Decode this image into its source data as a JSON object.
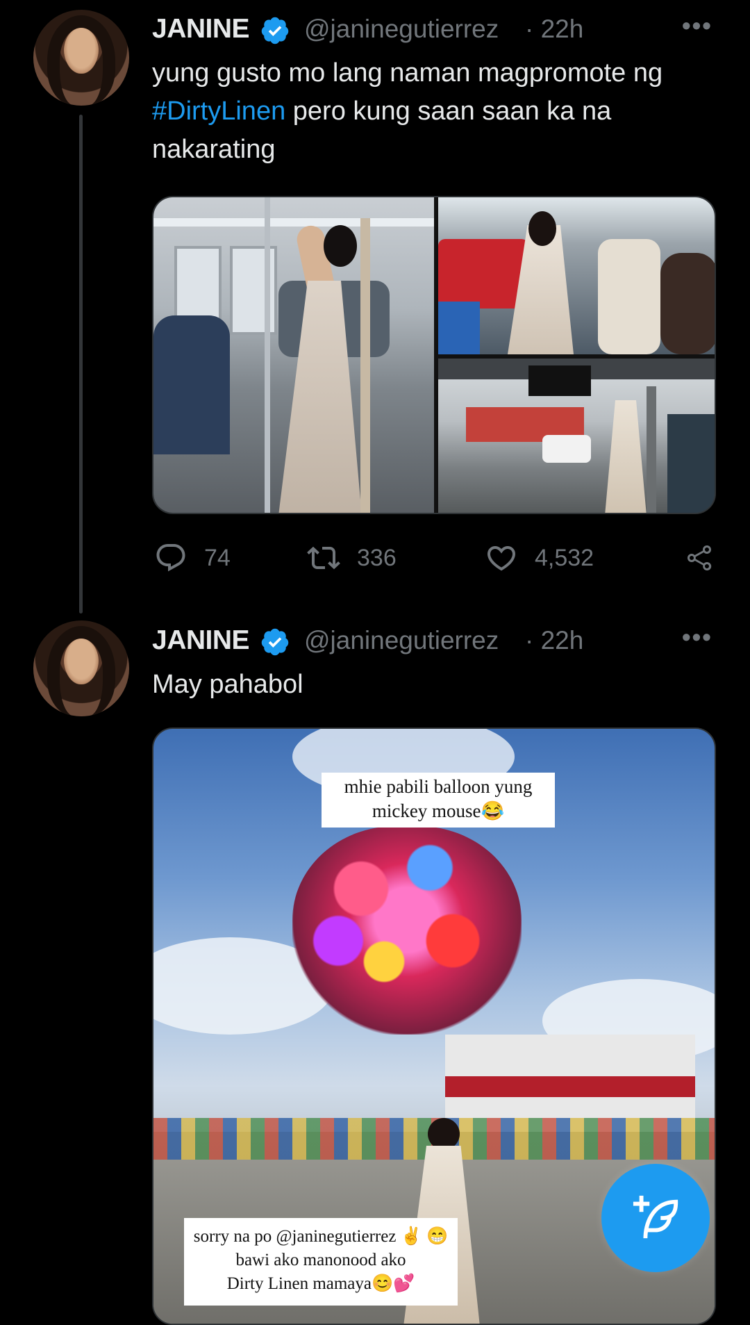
{
  "colors": {
    "background": "#000000",
    "accent": "#1d9bf0",
    "muted": "#71767b",
    "text": "#e7e9ea"
  },
  "tweet1": {
    "name": "JANINE",
    "handle": "@janinegutierrez",
    "time": "· 22h",
    "text_before": "yung gusto mo lang naman magpromote ng",
    "hashtag": "#DirtyLinen",
    "text_after": " pero kung saan saan ka na nakarating",
    "photos": [
      "train-interior-photo",
      "bus-interior-photo",
      "terminal-street-photo"
    ],
    "replies": "74",
    "retweets": "336",
    "likes": "4,532"
  },
  "tweet2": {
    "name": "JANINE",
    "handle": "@janinegutierrez",
    "time": "· 22h",
    "text": "May pahabol",
    "caption_top_line1": "mhie pabili balloon yung",
    "caption_top_line2": "mickey mouse😂",
    "caption_bottom_line1": "sorry na po @janinegutierrez ✌️ 😁",
    "caption_bottom_line2": "bawi ako manonood ako",
    "caption_bottom_line3": "Dirty Linen mamaya😊💕"
  },
  "icons": [
    "verified-icon",
    "more-icon",
    "reply-icon",
    "retweet-icon",
    "like-icon",
    "share-icon",
    "compose-tweet-icon"
  ]
}
